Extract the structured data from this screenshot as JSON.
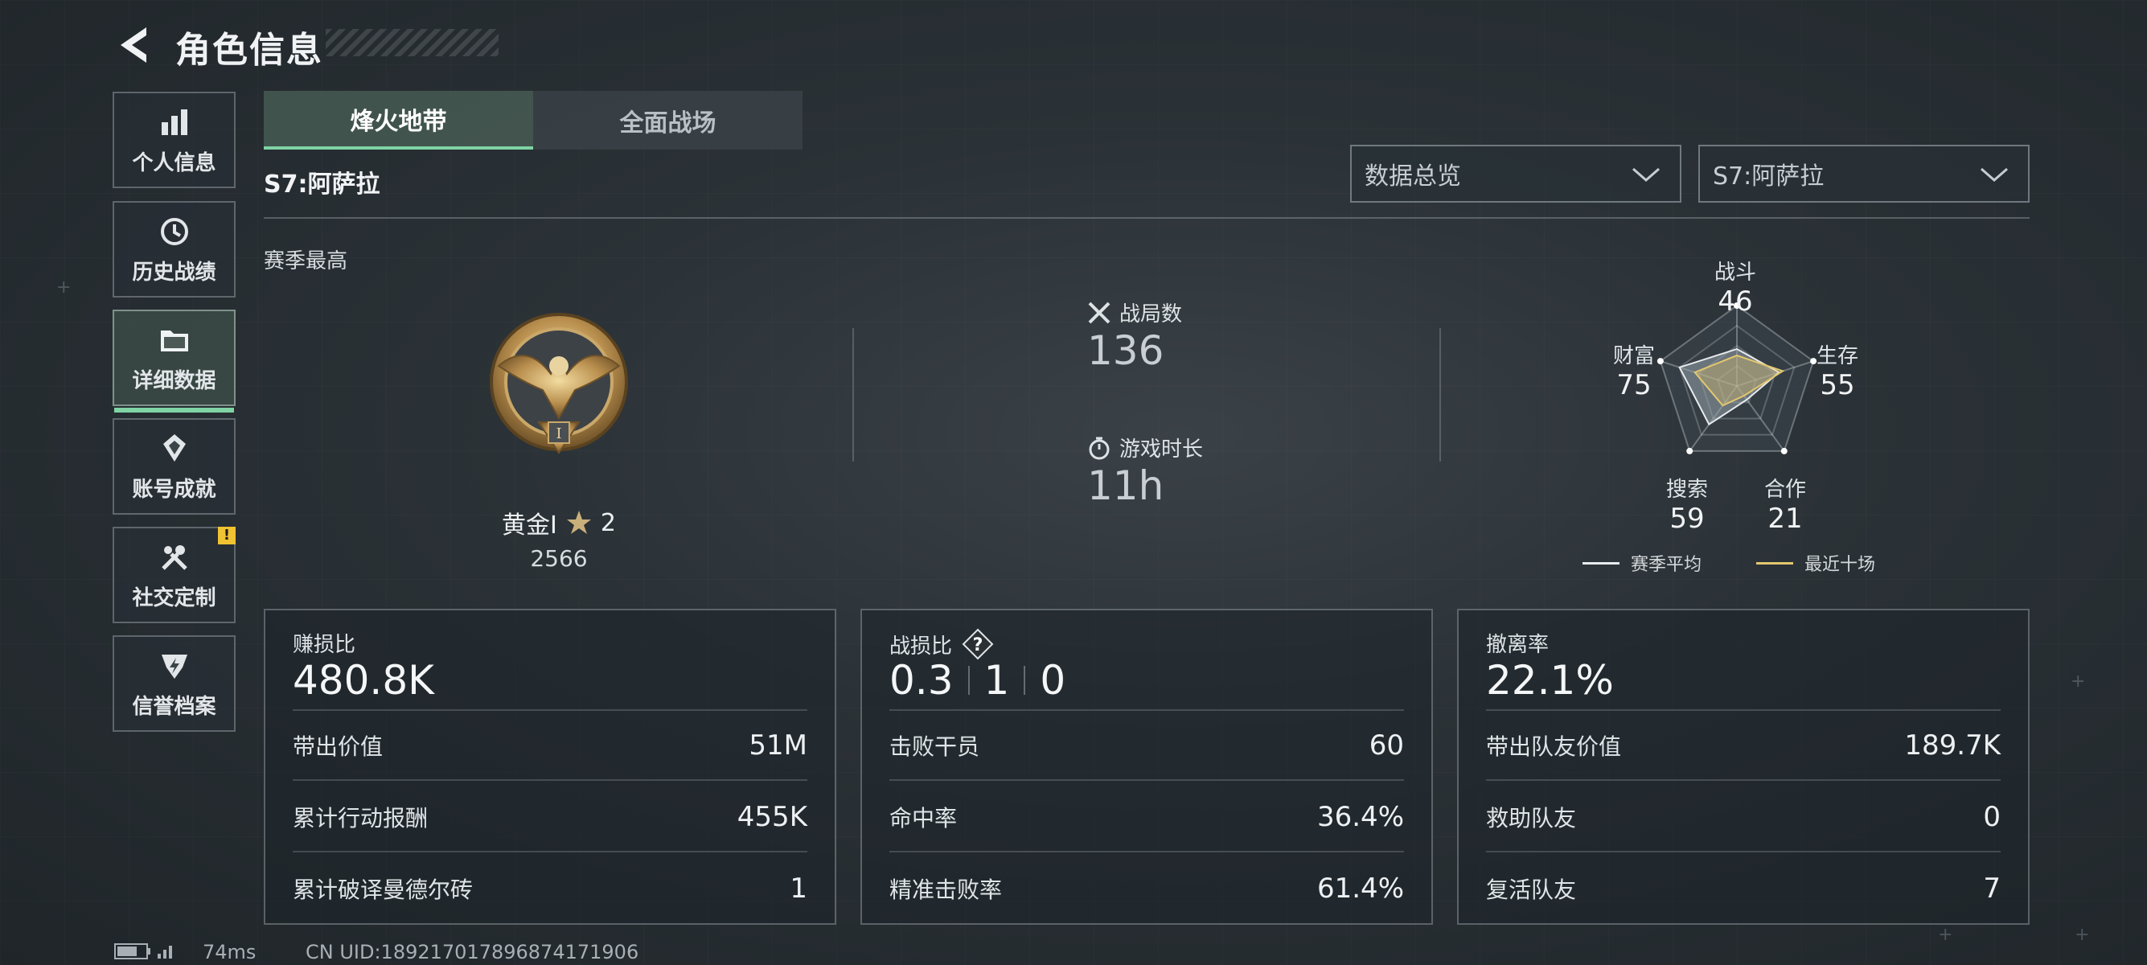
{
  "header": {
    "title": "角色信息"
  },
  "sidebar": {
    "items": [
      {
        "label": "个人信息"
      },
      {
        "label": "历史战绩"
      },
      {
        "label": "详细数据"
      },
      {
        "label": "账号成就"
      },
      {
        "label": "社交定制",
        "badge": "!"
      },
      {
        "label": "信誉档案"
      }
    ]
  },
  "tabs": [
    {
      "label": "烽火地带"
    },
    {
      "label": "全面战场"
    }
  ],
  "season_name": "S7:阿萨拉",
  "dropdowns": {
    "overview": "数据总览",
    "season": "S7:阿萨拉"
  },
  "season_high": {
    "label": "赛季最高",
    "rank": "黄金I",
    "stars": "2",
    "score": "2566"
  },
  "stats": {
    "matches_label": "战局数",
    "matches_value": "136",
    "playtime_label": "游戏时长",
    "playtime_value": "11h"
  },
  "radar": {
    "axes": [
      {
        "label": "战斗",
        "value": "46"
      },
      {
        "label": "生存",
        "value": "55"
      },
      {
        "label": "合作",
        "value": "21"
      },
      {
        "label": "搜索",
        "value": "59"
      },
      {
        "label": "财富",
        "value": "75"
      }
    ],
    "legend_avg": "赛季平均",
    "legend_recent": "最近十场",
    "colors": {
      "avg": "#e8ecef",
      "recent": "#e2c76e"
    }
  },
  "cards": [
    {
      "title": "赚损比",
      "big": "480.8K",
      "rows": [
        {
          "label": "带出价值",
          "value": "51M"
        },
        {
          "label": "累计行动报酬",
          "value": "455K"
        },
        {
          "label": "累计破译曼德尔砖",
          "value": "1"
        }
      ]
    },
    {
      "title": "战损比",
      "kd": [
        "0.3",
        "1",
        "0"
      ],
      "rows": [
        {
          "label": "击败干员",
          "value": "60"
        },
        {
          "label": "命中率",
          "value": "36.4%"
        },
        {
          "label": "精准击败率",
          "value": "61.4%"
        }
      ]
    },
    {
      "title": "撤离率",
      "big": "22.1%",
      "rows": [
        {
          "label": "带出队友价值",
          "value": "189.7K"
        },
        {
          "label": "救助队友",
          "value": "0"
        },
        {
          "label": "复活队友",
          "value": "7"
        }
      ]
    }
  ],
  "footer": {
    "ping": "74ms",
    "uid": "CN UID:1892170178968741719​06"
  },
  "accent": "#7fd3a4"
}
